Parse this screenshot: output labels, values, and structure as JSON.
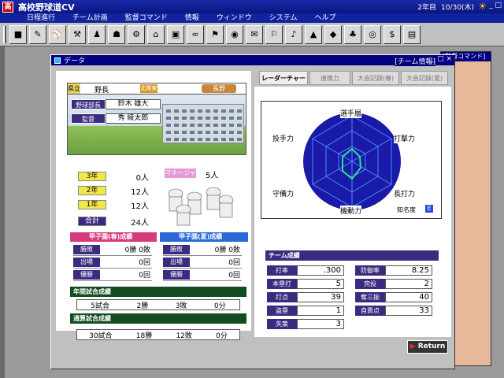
{
  "titlebar": {
    "app_icon": "高",
    "title": "高校野球道CV",
    "year": "2年目",
    "date": "10/30(木)",
    "weather_icon": "sun-icon",
    "controls": "_ □"
  },
  "menu": [
    "日程進行",
    "チーム計画",
    "監督コマンド",
    "情報",
    "ウィンドウ",
    "システム",
    "ヘルプ"
  ],
  "toolbar_icons": [
    "■",
    "✎",
    "⚾",
    "⚒",
    "♟",
    "☗",
    "⚙",
    "⌂",
    "▣",
    "∞",
    "⚑",
    "◉",
    "✉",
    "⚐",
    "♪",
    "▲",
    "◆",
    "♣",
    "◎",
    "$",
    "▤"
  ],
  "bg_window": {
    "title": "[監督コマンド]"
  },
  "window": {
    "title": "データ",
    "team_info": "[チーム情報]",
    "controls": "_ □ ×"
  },
  "school": {
    "type": "県立",
    "name": "野長",
    "region": "北関東",
    "pref": "長野",
    "manager_label": "野球部長",
    "manager_name": "鈴木 雄大",
    "coach_label": "監督",
    "coach_name": "秀 綾太郎"
  },
  "grades": [
    {
      "label": "3年",
      "value": "0人"
    },
    {
      "label": "2年",
      "value": "12人"
    },
    {
      "label": "1年",
      "value": "12人"
    },
    {
      "label": "合計",
      "value": "24人"
    }
  ],
  "manager_tag": {
    "label": "マネージャー",
    "value": "5人"
  },
  "koshien": {
    "spring": {
      "title": "甲子園(春)成績",
      "rows": [
        {
          "label": "勝敗",
          "value": "0勝 0敗"
        },
        {
          "label": "出場",
          "value": "0回"
        },
        {
          "label": "優勝",
          "value": "0回"
        }
      ]
    },
    "summer": {
      "title": "甲子園(夏)成績",
      "rows": [
        {
          "label": "勝敗",
          "value": "0勝 0敗"
        },
        {
          "label": "出場",
          "value": "0回"
        },
        {
          "label": "優勝",
          "value": "0回"
        }
      ]
    }
  },
  "year_games": {
    "title": "年間試合成績",
    "games": "5試合",
    "wins": "2勝",
    "losses": "3敗",
    "draws": "0分"
  },
  "total_games": {
    "title": "通算試合成績",
    "games": "30試合",
    "wins": "18勝",
    "losses": "12敗",
    "draws": "0分"
  },
  "tabs": [
    "レーダーチャート",
    "連携力",
    "大会記録(春)",
    "大会記録(夏)"
  ],
  "radar": {
    "labels": [
      "選手層",
      "打撃力",
      "長打力",
      "機動力",
      "守備力",
      "投手力"
    ],
    "fame_label": "知名度",
    "fame_icon": "E"
  },
  "team_stats": {
    "title": "チーム成績",
    "left": [
      {
        "label": "打率",
        "value": ".300"
      },
      {
        "label": "本塁打",
        "value": "5"
      },
      {
        "label": "打点",
        "value": "39"
      },
      {
        "label": "盗塁",
        "value": "1"
      },
      {
        "label": "失策",
        "value": "3"
      }
    ],
    "right": [
      {
        "label": "防御率",
        "value": "8.25"
      },
      {
        "label": "完投",
        "value": "2"
      },
      {
        "label": "奪三振",
        "value": "40"
      },
      {
        "label": "自責点",
        "value": "33"
      }
    ]
  },
  "return_label": "Return"
}
